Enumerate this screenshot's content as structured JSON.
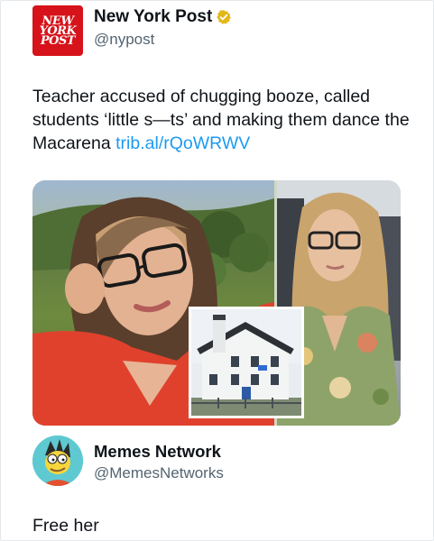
{
  "post": {
    "avatar_text": [
      "NEW",
      "YORK",
      "POST"
    ],
    "display_name": "New York Post",
    "handle": "@nypost",
    "text_main": "Teacher accused of chugging booze, called students ‘little s—ts’ and making them dance the Macarena ",
    "link": "trib.al/rQoWRWV",
    "verified_icon": "verified-gold-badge-icon",
    "colors": {
      "brand_red": "#d6121a",
      "link": "#1d9bf0",
      "verified_gold": "#e2b719"
    }
  },
  "media": {
    "photos": [
      "woman-selfie-red-top",
      "woman-glasses-floral-dress",
      "white-house-building"
    ]
  },
  "reply": {
    "display_name": "Memes Network",
    "handle": "@MemesNetworks",
    "text": "Free her"
  }
}
